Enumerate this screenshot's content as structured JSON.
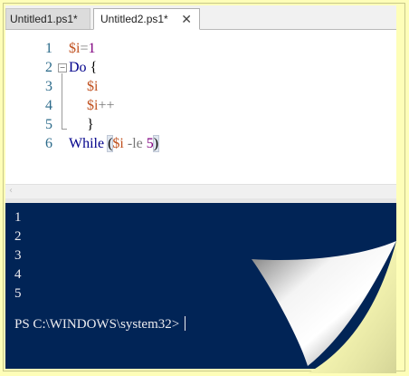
{
  "tabs": [
    {
      "label": "Untitled1.ps1*",
      "active": false
    },
    {
      "label": "Untitled2.ps1*",
      "active": true
    }
  ],
  "close_icon": "✕",
  "editor": {
    "line_numbers": [
      "1",
      "2",
      "3",
      "4",
      "5",
      "6"
    ],
    "lines": {
      "l1": {
        "var": "$i",
        "op": "=",
        "num": "1"
      },
      "l2": {
        "kw": "Do",
        "punc": " {"
      },
      "l3": {
        "var": "$i"
      },
      "l4": {
        "var": "$i",
        "op": "++"
      },
      "l5": {
        "punc": "}"
      },
      "l6": {
        "kw": "While",
        "open": "(",
        "var": "$i",
        "op": " -le ",
        "num": "5",
        "close": ")"
      }
    },
    "fold_glyph": "−"
  },
  "scroll_arrow": "‹",
  "console": {
    "output": [
      "1",
      "2",
      "3",
      "4",
      "5"
    ],
    "prompt": "PS C:\\WINDOWS\\system32>"
  },
  "colors": {
    "console_bg": "#012456",
    "variable": "#c0501e",
    "keyword": "#00008b",
    "number": "#800080",
    "line_number": "#2b6a8a",
    "page_bg": "#fefeb8"
  }
}
